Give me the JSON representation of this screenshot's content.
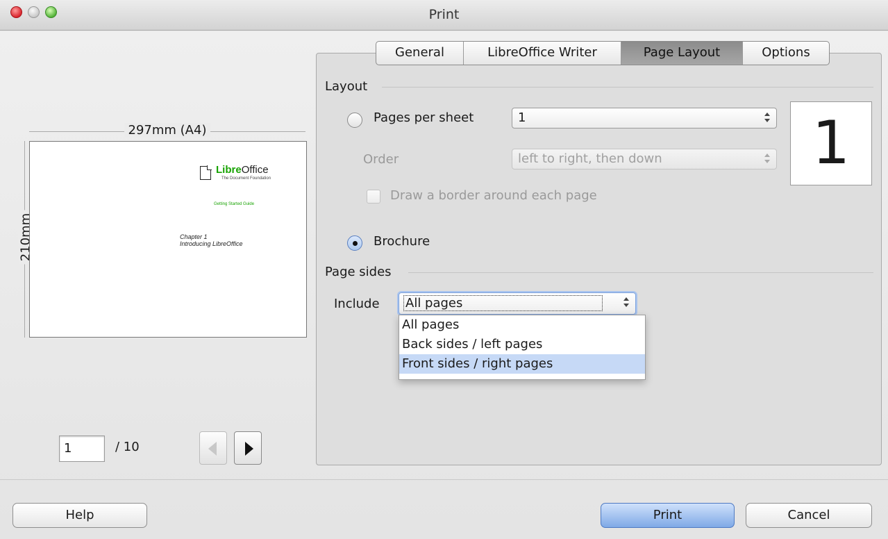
{
  "window": {
    "title": "Print"
  },
  "preview": {
    "width_label": "297mm (A4)",
    "height_label": "210mm",
    "doc_brand_prefix": "Libre",
    "doc_brand_suffix": "Office",
    "doc_brand_sub": "The Document Foundation",
    "doc_guide": "Getting Started Guide",
    "doc_chapter": "Chapter 1",
    "doc_chapter_title": "Introducing LibreOffice",
    "page_current": "1",
    "page_total": "/ 10"
  },
  "tabs": [
    {
      "label": "General",
      "active": false
    },
    {
      "label": "LibreOffice Writer",
      "active": false
    },
    {
      "label": "Page Layout",
      "active": true
    },
    {
      "label": "Options",
      "active": false
    }
  ],
  "layout": {
    "section_label": "Layout",
    "pages_per_sheet_label": "Pages per sheet",
    "pages_per_sheet_value": "1",
    "order_label": "Order",
    "order_value": "left to right, then down",
    "border_label": "Draw a border around each page",
    "brochure_label": "Brochure",
    "preview_number": "1"
  },
  "page_sides": {
    "section_label": "Page sides",
    "include_label": "Include",
    "include_value": "All pages",
    "options": [
      "All pages",
      "Back sides / left pages",
      "Front sides / right pages"
    ],
    "highlighted_option": 2
  },
  "buttons": {
    "help": "Help",
    "print": "Print",
    "cancel": "Cancel"
  },
  "colors": {
    "accent": "#7fa9e6",
    "brand_green": "#18a303",
    "highlight": "#c6d9f6"
  }
}
